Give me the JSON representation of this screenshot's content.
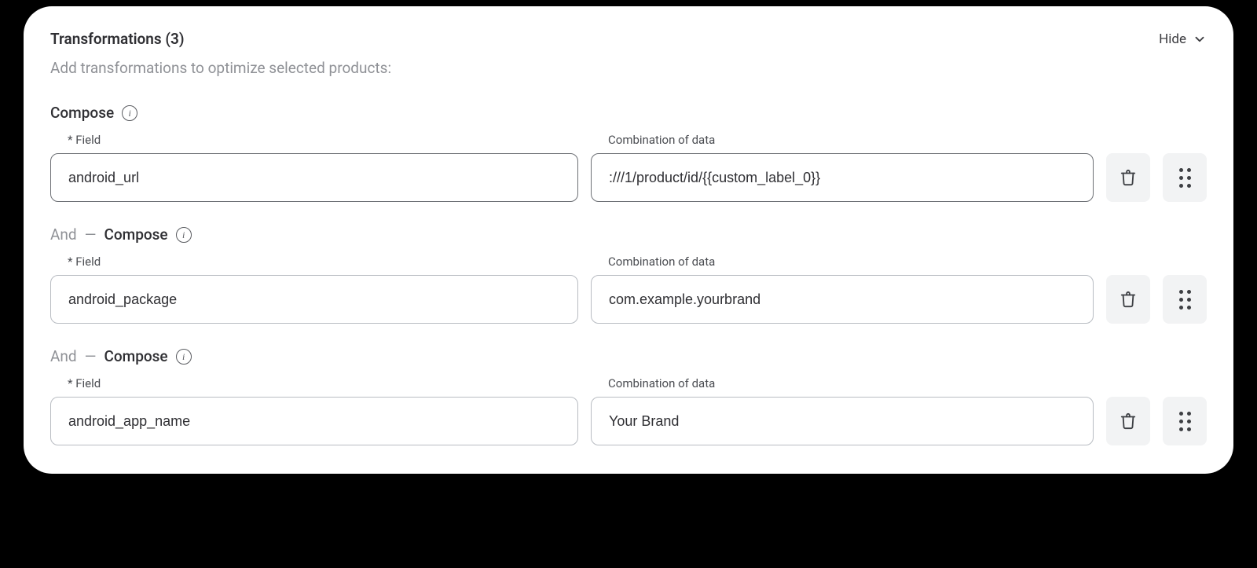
{
  "header": {
    "title_prefix": "Transformations",
    "count_display": "(3)",
    "hide_label": "Hide"
  },
  "subtitle": "Add transformations to optimize selected products:",
  "labels": {
    "field": "Field",
    "combination": "Combination of data",
    "and": "And",
    "dash": "—",
    "compose": "Compose"
  },
  "rows": [
    {
      "field_value": "android_url",
      "data_value": ":///1/product/id/{{custom_label_0}}"
    },
    {
      "field_value": "android_package",
      "data_value": "com.example.yourbrand"
    },
    {
      "field_value": "android_app_name",
      "data_value": "Your Brand"
    }
  ]
}
